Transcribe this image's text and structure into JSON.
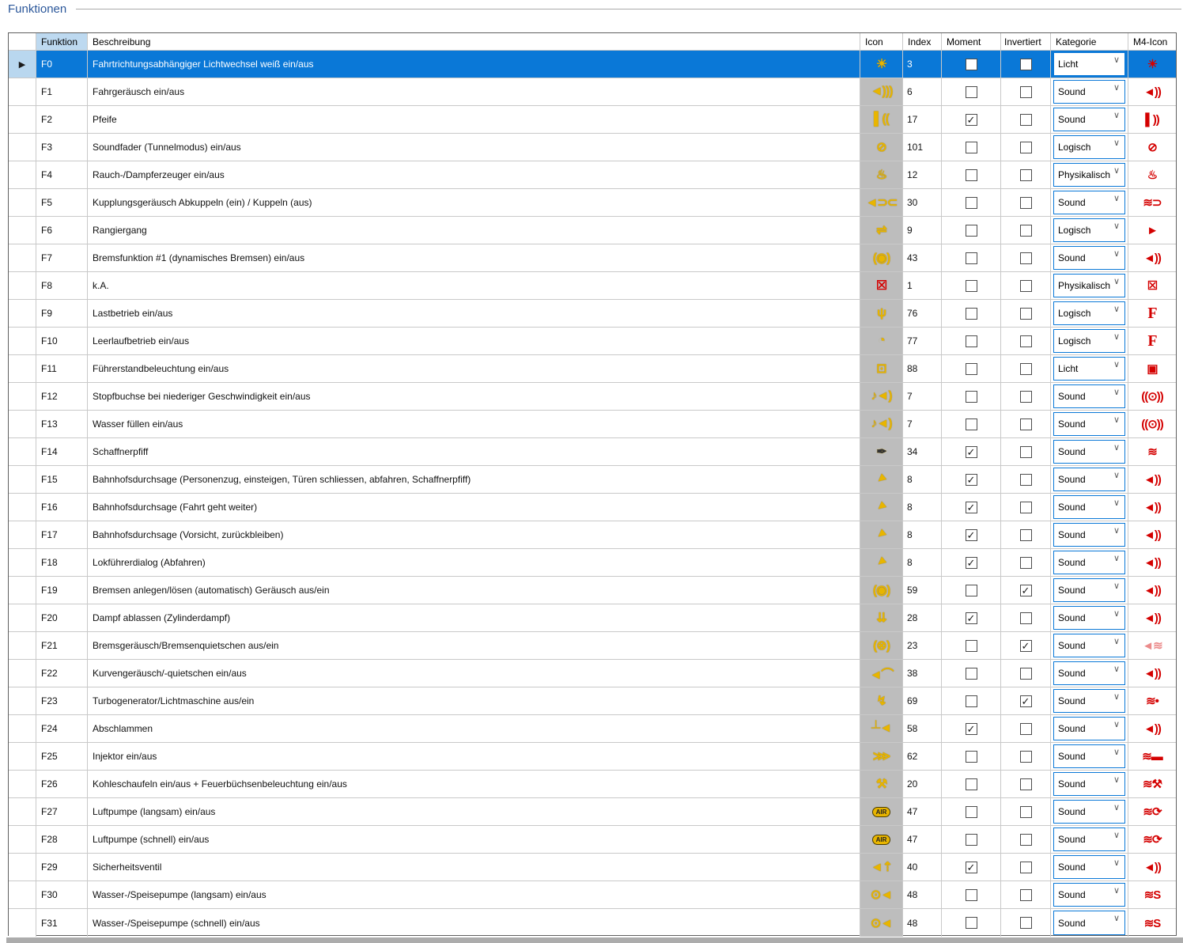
{
  "title": "Funktionen",
  "colors": {
    "accent_selected_row": "#0A78D7",
    "header_funktion_bg": "#BDD9F0",
    "icon_column_bg": "#BDBDBD",
    "icon_yellow": "#E8B500",
    "m4_icon_red": "#D40000",
    "grid_line": "#C9C9C9",
    "title_blue": "#2B579A",
    "scrollbar_gray": "#ACACAC"
  },
  "table": {
    "columns": [
      "Funktion",
      "Beschreibung",
      "Icon",
      "Index",
      "Moment",
      "Invertiert",
      "Kategorie",
      "M4-Icon"
    ],
    "selected_row": 0,
    "kategorie_values_visible": [
      "Licht",
      "Sound",
      "Logisch",
      "Physikalisch"
    ],
    "rows": [
      {
        "funktion": "F0",
        "beschreibung": "Fahrtrichtungsabhängiger Lichtwechsel weiß ein/aus",
        "index": "3",
        "moment": false,
        "invertiert": false,
        "kategorie": "Licht",
        "icon": {
          "name": "light-icon",
          "glyph": "☀"
        },
        "m4": {
          "name": "m4-light-icon",
          "glyph": "☀"
        }
      },
      {
        "funktion": "F1",
        "beschreibung": "Fahrgeräusch ein/aus",
        "index": "6",
        "moment": false,
        "invertiert": false,
        "kategorie": "Sound",
        "icon": {
          "name": "speaker-icon",
          "glyph": "◄)))"
        },
        "m4": {
          "name": "m4-speaker-icon",
          "glyph": "◄))"
        }
      },
      {
        "funktion": "F2",
        "beschreibung": "Pfeife",
        "index": "17",
        "moment": true,
        "invertiert": false,
        "kategorie": "Sound",
        "icon": {
          "name": "whistle-icon",
          "glyph": "▌(("
        },
        "m4": {
          "name": "m4-whistle-icon",
          "glyph": "▌))"
        }
      },
      {
        "funktion": "F3",
        "beschreibung": "Soundfader (Tunnelmodus) ein/aus",
        "index": "101",
        "moment": false,
        "invertiert": false,
        "kategorie": "Logisch",
        "icon": {
          "name": "mute-icon",
          "glyph": "⊘"
        },
        "m4": {
          "name": "m4-mute-icon",
          "glyph": "⊘"
        }
      },
      {
        "funktion": "F4",
        "beschreibung": "Rauch-/Dampferzeuger ein/aus",
        "index": "12",
        "moment": false,
        "invertiert": false,
        "kategorie": "Physikalisch",
        "icon": {
          "name": "smoke-icon",
          "glyph": "♨"
        },
        "m4": {
          "name": "m4-smoke-icon",
          "glyph": "♨"
        }
      },
      {
        "funktion": "F5",
        "beschreibung": "Kupplungsgeräusch Abkuppeln (ein) / Kuppeln (aus)",
        "index": "30",
        "moment": false,
        "invertiert": false,
        "kategorie": "Sound",
        "icon": {
          "name": "coupler-sound-icon",
          "glyph": "◄⊃⊂"
        },
        "m4": {
          "name": "m4-coupler-icon",
          "glyph": "≋⊃"
        }
      },
      {
        "funktion": "F6",
        "beschreibung": "Rangiergang",
        "index": "9",
        "moment": false,
        "invertiert": false,
        "kategorie": "Logisch",
        "icon": {
          "name": "shunting-loco-icon",
          "glyph": "⇌"
        },
        "m4": {
          "name": "m4-shunting-loco-icon",
          "glyph": "►"
        }
      },
      {
        "funktion": "F7",
        "beschreibung": "Bremsfunktion #1 (dynamisches Bremsen) ein/aus",
        "index": "43",
        "moment": false,
        "invertiert": false,
        "kategorie": "Sound",
        "icon": {
          "name": "brake-icon",
          "glyph": "(◉)"
        },
        "m4": {
          "name": "m4-speaker-icon",
          "glyph": "◄))"
        }
      },
      {
        "funktion": "F8",
        "beschreibung": "k.A.",
        "index": "1",
        "moment": false,
        "invertiert": false,
        "kategorie": "Physikalisch",
        "icon": {
          "name": "red-x-icon",
          "glyph": "☒",
          "cls": "red"
        },
        "m4": {
          "name": "m4-red-x-icon",
          "glyph": "☒"
        }
      },
      {
        "funktion": "F9",
        "beschreibung": "Lastbetrieb ein/aus",
        "index": "76",
        "moment": false,
        "invertiert": false,
        "kategorie": "Logisch",
        "icon": {
          "name": "load-figure-icon",
          "glyph": "ψ"
        },
        "m4": {
          "name": "m4-letter-f-icon",
          "glyph": "F",
          "cls": "letterF"
        }
      },
      {
        "funktion": "F10",
        "beschreibung": "Leerlaufbetrieb ein/aus",
        "index": "77",
        "moment": false,
        "invertiert": false,
        "kategorie": "Logisch",
        "icon": {
          "name": "idle-gauge-icon",
          "glyph": "◔"
        },
        "m4": {
          "name": "m4-letter-f-icon",
          "glyph": "F",
          "cls": "letterF"
        }
      },
      {
        "funktion": "F11",
        "beschreibung": "Führerstandbeleuchtung ein/aus",
        "index": "88",
        "moment": false,
        "invertiert": false,
        "kategorie": "Licht",
        "icon": {
          "name": "cab-light-icon",
          "glyph": "⊡"
        },
        "m4": {
          "name": "m4-cab-icon",
          "glyph": "▣"
        }
      },
      {
        "funktion": "F12",
        "beschreibung": "Stopfbuchse bei niederiger Geschwindigkeit ein/aus",
        "index": "7",
        "moment": false,
        "invertiert": false,
        "kategorie": "Sound",
        "icon": {
          "name": "note-speaker-icon",
          "glyph": "♪◄)"
        },
        "m4": {
          "name": "m4-ring-sound-icon",
          "glyph": "((⊙))"
        }
      },
      {
        "funktion": "F13",
        "beschreibung": "Wasser füllen ein/aus",
        "index": "7",
        "moment": false,
        "invertiert": false,
        "kategorie": "Sound",
        "icon": {
          "name": "note-speaker-icon",
          "glyph": "♪◄)"
        },
        "m4": {
          "name": "m4-ring-sound-icon",
          "glyph": "((⊙))"
        }
      },
      {
        "funktion": "F14",
        "beschreibung": "Schaffnerpfiff",
        "index": "34",
        "moment": true,
        "invertiert": false,
        "kategorie": "Sound",
        "icon": {
          "name": "conductor-whistle-icon",
          "glyph": "✒",
          "cls": "dark"
        },
        "m4": {
          "name": "m4-waves-icon",
          "glyph": "≋"
        }
      },
      {
        "funktion": "F15",
        "beschreibung": "Bahnhofsdurchsage (Personenzug, einsteigen, Türen schliessen, abfahren, Schaffnerpfiff)",
        "index": "8",
        "moment": true,
        "invertiert": false,
        "kategorie": "Sound",
        "icon": {
          "name": "megaphone-icon",
          "glyph": "◄",
          "cls": "rot45"
        },
        "m4": {
          "name": "m4-speaker-icon",
          "glyph": "◄))"
        }
      },
      {
        "funktion": "F16",
        "beschreibung": "Bahnhofsdurchsage (Fahrt geht weiter)",
        "index": "8",
        "moment": true,
        "invertiert": false,
        "kategorie": "Sound",
        "icon": {
          "name": "megaphone-icon",
          "glyph": "◄",
          "cls": "rot45"
        },
        "m4": {
          "name": "m4-speaker-icon",
          "glyph": "◄))"
        }
      },
      {
        "funktion": "F17",
        "beschreibung": "Bahnhofsdurchsage (Vorsicht, zurückbleiben)",
        "index": "8",
        "moment": true,
        "invertiert": false,
        "kategorie": "Sound",
        "icon": {
          "name": "megaphone-icon",
          "glyph": "◄",
          "cls": "rot45"
        },
        "m4": {
          "name": "m4-speaker-icon",
          "glyph": "◄))"
        }
      },
      {
        "funktion": "F18",
        "beschreibung": "Lokführerdialog (Abfahren)",
        "index": "8",
        "moment": true,
        "invertiert": false,
        "kategorie": "Sound",
        "icon": {
          "name": "megaphone-icon",
          "glyph": "◄",
          "cls": "rot45"
        },
        "m4": {
          "name": "m4-speaker-icon",
          "glyph": "◄))"
        }
      },
      {
        "funktion": "F19",
        "beschreibung": "Bremsen anlegen/lösen (automatisch) Geräusch aus/ein",
        "index": "59",
        "moment": false,
        "invertiert": true,
        "kategorie": "Sound",
        "icon": {
          "name": "brake-sound-icon",
          "glyph": "(◉)"
        },
        "m4": {
          "name": "m4-speaker-icon",
          "glyph": "◄))"
        }
      },
      {
        "funktion": "F20",
        "beschreibung": "Dampf ablassen (Zylinderdampf)",
        "index": "28",
        "moment": true,
        "invertiert": false,
        "kategorie": "Sound",
        "icon": {
          "name": "cylinder-steam-icon",
          "glyph": "⇊"
        },
        "m4": {
          "name": "m4-speaker-icon",
          "glyph": "◄))"
        }
      },
      {
        "funktion": "F21",
        "beschreibung": "Bremsgeräusch/Bremsenquietschen aus/ein",
        "index": "23",
        "moment": false,
        "invertiert": true,
        "kategorie": "Sound",
        "icon": {
          "name": "brake-squeal-icon",
          "glyph": "(⊗)"
        },
        "m4": {
          "name": "m4-speaker-faded-icon",
          "glyph": "◄≋",
          "cls": "faded"
        }
      },
      {
        "funktion": "F22",
        "beschreibung": "Kurvengeräusch/-quietschen ein/aus",
        "index": "38",
        "moment": false,
        "invertiert": false,
        "kategorie": "Sound",
        "icon": {
          "name": "curve-squeal-icon",
          "glyph": "◄⌒"
        },
        "m4": {
          "name": "m4-speaker-icon",
          "glyph": "◄))"
        }
      },
      {
        "funktion": "F23",
        "beschreibung": "Turbogenerator/Lichtmaschine aus/ein",
        "index": "69",
        "moment": false,
        "invertiert": true,
        "kategorie": "Sound",
        "icon": {
          "name": "generator-icon",
          "glyph": "↯"
        },
        "m4": {
          "name": "m4-waves-dot-icon",
          "glyph": "≋•"
        }
      },
      {
        "funktion": "F24",
        "beschreibung": "Abschlammen",
        "index": "58",
        "moment": true,
        "invertiert": false,
        "kategorie": "Sound",
        "icon": {
          "name": "blowdown-valve-icon",
          "glyph": "┴◄"
        },
        "m4": {
          "name": "m4-speaker-icon",
          "glyph": "◄))"
        }
      },
      {
        "funktion": "F25",
        "beschreibung": "Injektor ein/aus",
        "index": "62",
        "moment": false,
        "invertiert": false,
        "kategorie": "Sound",
        "icon": {
          "name": "injector-icon",
          "glyph": "⋙"
        },
        "m4": {
          "name": "m4-waves-bar-icon",
          "glyph": "≋▬"
        }
      },
      {
        "funktion": "F26",
        "beschreibung": "Kohleschaufeln ein/aus + Feuerbüchsenbeleuchtung ein/aus",
        "index": "20",
        "moment": false,
        "invertiert": false,
        "kategorie": "Sound",
        "icon": {
          "name": "coal-shovel-icon",
          "glyph": "⚒"
        },
        "m4": {
          "name": "m4-waves-shovel-icon",
          "glyph": "≋⚒"
        }
      },
      {
        "funktion": "F27",
        "beschreibung": "Luftpumpe (langsam) ein/aus",
        "index": "47",
        "moment": false,
        "invertiert": false,
        "kategorie": "Sound",
        "icon": {
          "name": "air-pump-icon",
          "glyph": "AIR",
          "cls": "air-badge"
        },
        "m4": {
          "name": "m4-waves-pump-icon",
          "glyph": "≋⟳"
        }
      },
      {
        "funktion": "F28",
        "beschreibung": "Luftpumpe (schnell) ein/aus",
        "index": "47",
        "moment": false,
        "invertiert": false,
        "kategorie": "Sound",
        "icon": {
          "name": "air-pump-icon",
          "glyph": "AIR",
          "cls": "air-badge"
        },
        "m4": {
          "name": "m4-waves-pump-icon",
          "glyph": "≋⟳"
        }
      },
      {
        "funktion": "F29",
        "beschreibung": "Sicherheitsventil",
        "index": "40",
        "moment": true,
        "invertiert": false,
        "kategorie": "Sound",
        "icon": {
          "name": "safety-valve-icon",
          "glyph": "◄⇡"
        },
        "m4": {
          "name": "m4-speaker-icon",
          "glyph": "◄))"
        }
      },
      {
        "funktion": "F30",
        "beschreibung": "Wasser-/Speisepumpe (langsam) ein/aus",
        "index": "48",
        "moment": false,
        "invertiert": false,
        "kategorie": "Sound",
        "icon": {
          "name": "water-pump-icon",
          "glyph": "⊙◄"
        },
        "m4": {
          "name": "m4-waves-s-icon",
          "glyph": "≋S"
        }
      },
      {
        "funktion": "F31",
        "beschreibung": "Wasser-/Speisepumpe (schnell) ein/aus",
        "index": "48",
        "moment": false,
        "invertiert": false,
        "kategorie": "Sound",
        "icon": {
          "name": "water-pump-icon",
          "glyph": "⊙◄"
        },
        "m4": {
          "name": "m4-waves-s-icon",
          "glyph": "≋S"
        }
      }
    ]
  }
}
